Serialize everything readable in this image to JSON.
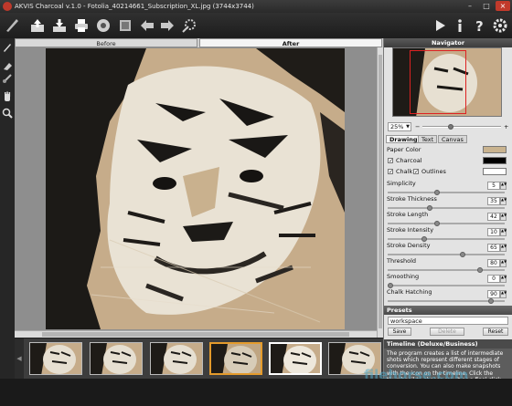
{
  "window": {
    "title": "AKVIS Charcoal v.1.0 - Fotolia_40214661_Subscription_XL.jpg (3744x3744)",
    "buttons": {
      "minimize": "–",
      "maximize": "□",
      "close": "×"
    }
  },
  "toolbar": {
    "left_icons": [
      "charcoal-logo-icon",
      "open-icon",
      "save-icon",
      "print-icon",
      "share-icon",
      "undo-icon",
      "redo-icon",
      "settings-icon"
    ],
    "right_icons": [
      "run-icon",
      "info-icon",
      "help-icon",
      "preferences-icon"
    ]
  },
  "left_tools": [
    "pencil-icon",
    "eraser-icon",
    "stroke-icon",
    "hand-icon",
    "zoom-icon"
  ],
  "view_tabs": {
    "before": "Before",
    "after": "After"
  },
  "navigator": {
    "title": "Navigator",
    "zoom": "25%"
  },
  "settings_tabs": {
    "drawing": "Drawing",
    "text": "Text",
    "canvas": "Canvas"
  },
  "drawing": {
    "paper_color_label": "Paper Color",
    "charcoal_label": "Charcoal",
    "chalk_label": "Chalk",
    "outlines_label": "Outlines",
    "colors": {
      "paper": "#c9b38f",
      "charcoal": "#000000",
      "chalk": "#ffffff"
    },
    "params": [
      {
        "label": "Simplicity",
        "value": "5",
        "level": 0.42
      },
      {
        "label": "Stroke Thickness",
        "value": "35",
        "level": 0.35
      },
      {
        "label": "Stroke Length",
        "value": "42",
        "level": 0.42
      },
      {
        "label": "Stroke Intensity",
        "value": "10",
        "level": 0.3
      },
      {
        "label": "Stroke Density",
        "value": "65",
        "level": 0.65
      },
      {
        "label": "Threshold",
        "value": "80",
        "level": 0.8
      },
      {
        "label": "Smoothing",
        "value": "0",
        "level": 0.0
      },
      {
        "label": "Chalk Hatching",
        "value": "90",
        "level": 0.9
      }
    ]
  },
  "presets": {
    "title": "Presets",
    "current": "workspace",
    "save": "Save",
    "delete": "Delete",
    "reset": "Reset"
  },
  "timeline": {
    "title": "Timeline (Deluxe/Business)",
    "text": "The program creates a list of intermediate shots which represent different stages of conversion. You can also make snapshots with the icon on the timeline. Click the thumbnail to choose result as a final click you can scroll up in the list. You can hide/show the Timeline in the preferences."
  },
  "watermark": "filehorse.com"
}
